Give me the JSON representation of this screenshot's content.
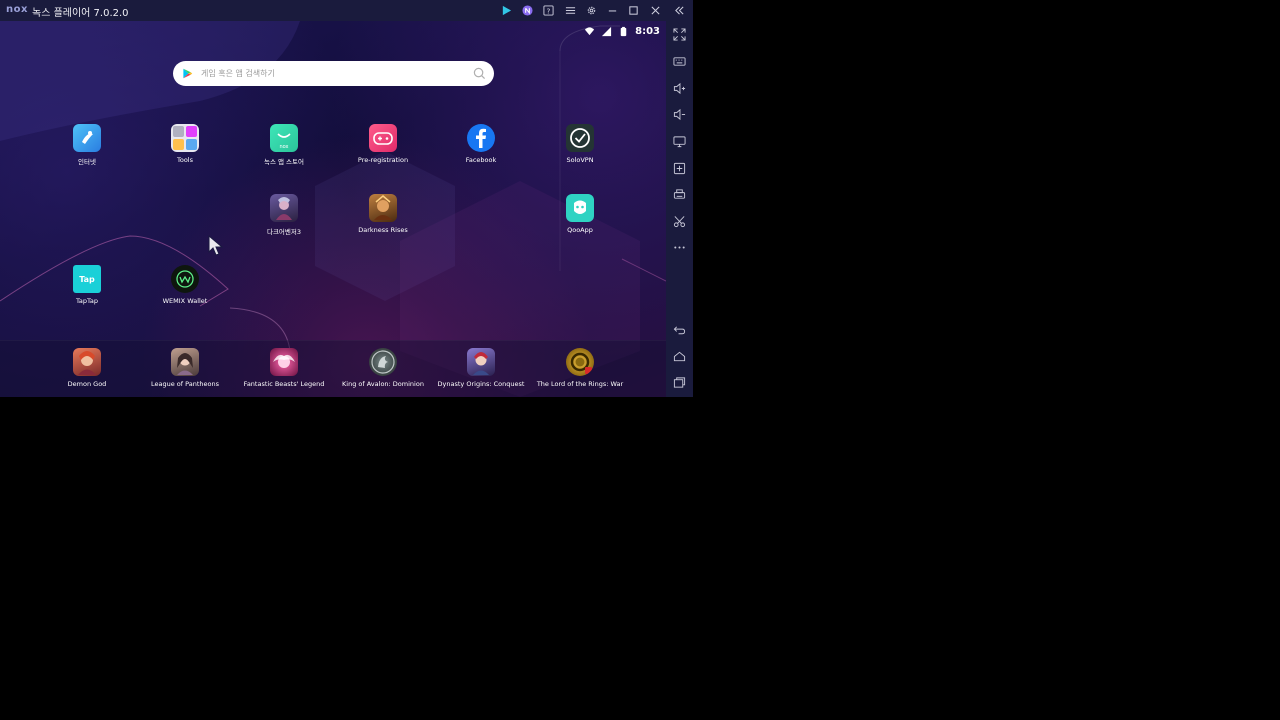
{
  "window": {
    "logo": "nox",
    "title": "녹스 플레이어 7.0.2.0"
  },
  "status_bar": {
    "time": "8:03"
  },
  "search": {
    "placeholder": "게임 혹은 앱 검색하기"
  },
  "home_apps": [
    {
      "label": "인터넷",
      "icon": "internet-icon",
      "color": "#3aa8f0"
    },
    {
      "label": "Tools",
      "icon": "tools-icon",
      "color": "#e8e8f0"
    },
    {
      "label": "녹스 앱 스토어",
      "icon": "nox-app-store-icon",
      "color": "#36d6a8"
    },
    {
      "label": "Pre-registration",
      "icon": "gamepad-icon",
      "color": "#f0427a"
    },
    {
      "label": "Facebook",
      "icon": "facebook-icon",
      "color": "#1877f2"
    },
    {
      "label": "SoloVPN",
      "icon": "solovpn-icon",
      "color": "#2a3a3a"
    },
    {
      "label": "다크어벤저3",
      "icon": "dark-avenger-3-icon",
      "color": "#4a3a6a"
    },
    {
      "label": "Darkness Rises",
      "icon": "darkness-rises-icon",
      "color": "#8a5a2a"
    },
    {
      "label": "QooApp",
      "icon": "qooapp-icon",
      "color": "#2fd3c3"
    },
    {
      "label": "TapTap",
      "icon": "taptap-icon",
      "color": "#1ad0d8"
    },
    {
      "label": "WEMIX Wallet",
      "icon": "wemix-wallet-icon",
      "color": "#1a2a1a"
    }
  ],
  "dock_apps": [
    {
      "label": "Demon God",
      "icon": "demon-god-icon",
      "color": "#c85a4a"
    },
    {
      "label": "League of Pantheons",
      "icon": "league-of-pantheons-icon",
      "color": "#8a6a5a"
    },
    {
      "label": "Fantastic Beasts' Legend",
      "icon": "fantastic-beasts-legend-icon",
      "color": "#c8287a"
    },
    {
      "label": "King of Avalon: Dominion",
      "icon": "king-of-avalon-icon",
      "color": "#4a5a5a"
    },
    {
      "label": "Dynasty Origins: Conquest",
      "icon": "dynasty-origins-icon",
      "color": "#6a5aa0"
    },
    {
      "label": "The Lord of the Rings: War",
      "icon": "lord-of-the-rings-icon",
      "color": "#c8a020"
    }
  ],
  "colors": {
    "titlebar": "#1a1b3d",
    "accent": "#7a6cf0"
  }
}
